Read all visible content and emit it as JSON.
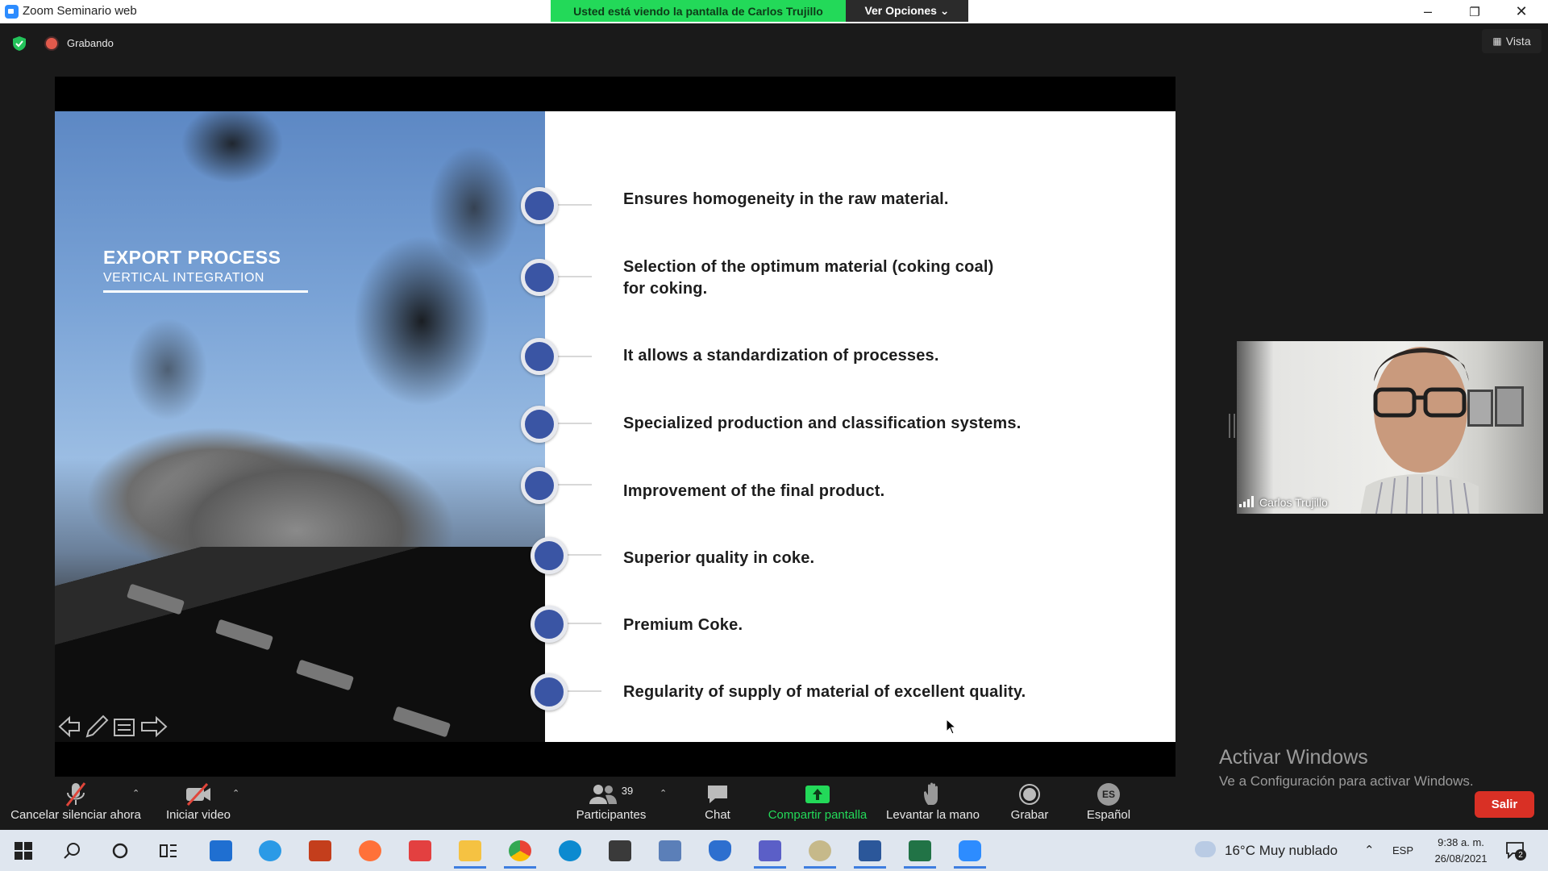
{
  "window": {
    "title": "Zoom Seminario web",
    "minimize": "–",
    "restore": "❐",
    "close": "✕"
  },
  "share_banner": {
    "text": "Usted está viendo la pantalla de Carlos Trujillo",
    "options_label": "Ver Opciones ⌄"
  },
  "status": {
    "recording_label": "Grabando",
    "view_label": "Vista"
  },
  "slide": {
    "title": "EXPORT PROCESS",
    "subtitle": "VERTICAL INTEGRATION",
    "bullets": [
      "Ensures homogeneity in the raw material.",
      "Selection of the optimum material (coking coal)",
      "for coking.",
      "It allows a standardization of processes.",
      "Specialized production and classification systems.",
      "Improvement of the final product.",
      "Superior quality in coke.",
      "Premium Coke.",
      "Regularity of supply of material of excellent quality."
    ]
  },
  "video": {
    "participant_name": "Carlos Trujillo"
  },
  "watermark": {
    "title": "Activar Windows",
    "subtitle": "Ve a Configuración para activar Windows."
  },
  "toolbar": {
    "mute_label": "Cancelar silenciar ahora",
    "video_label": "Iniciar video",
    "participants_label": "Participantes",
    "participants_count": "39",
    "chat_label": "Chat",
    "share_label": "Compartir pantalla",
    "raise_hand_label": "Levantar la mano",
    "record_label": "Grabar",
    "language_label": "Español",
    "language_code": "ES",
    "leave_label": "Salir"
  },
  "taskbar": {
    "weather": "16°C  Muy nublado",
    "language": "ESP",
    "time": "9:38 a. m.",
    "date": "26/08/2021",
    "notifications": "2"
  },
  "colors": {
    "share_green": "#23d959",
    "leave_red": "#d93025",
    "bullet_blue": "#3a55a4",
    "zoom_blue": "#2d8cff"
  }
}
